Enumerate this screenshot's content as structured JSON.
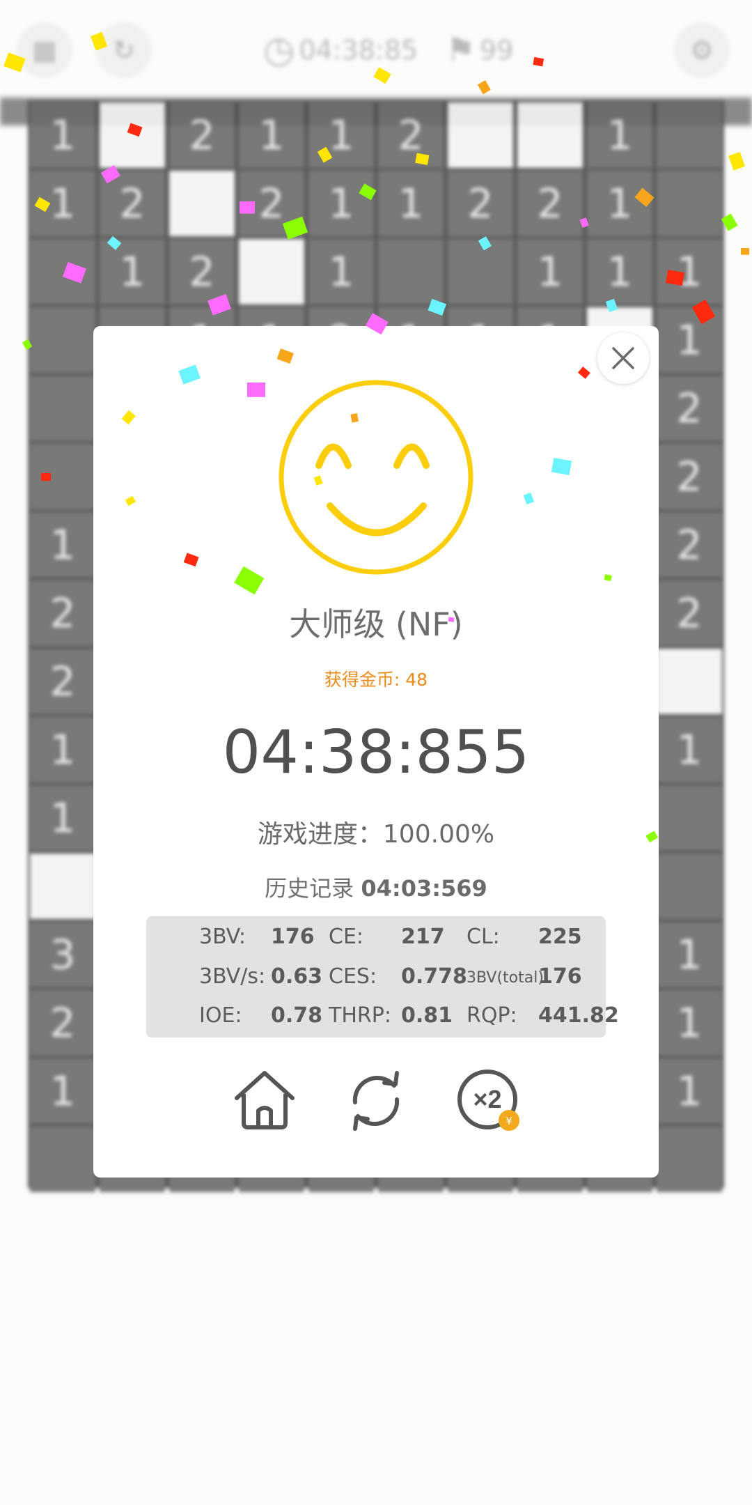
{
  "topbar": {
    "timer_text": "04:38:85",
    "flags_text": "99"
  },
  "board": {
    "rows": [
      [
        "1",
        "",
        "2",
        "1",
        "1",
        "2",
        "",
        "",
        "1",
        ""
      ],
      [
        "1",
        "2",
        "",
        "2",
        "1",
        "1",
        "2",
        "2",
        "1",
        ""
      ],
      [
        "",
        "1",
        "2",
        "",
        "1",
        "",
        "",
        "1",
        "1",
        "1"
      ],
      [
        "",
        "",
        "1",
        "1",
        "2",
        "1",
        "1",
        "1",
        "",
        "1"
      ],
      [
        "",
        "",
        "",
        "",
        "",
        "",
        "",
        "",
        "",
        "2"
      ],
      [
        "",
        "",
        "",
        "",
        "",
        "",
        "",
        "",
        "",
        "2"
      ],
      [
        "1",
        "",
        "",
        "",
        "",
        "",
        "",
        "",
        "",
        "2"
      ],
      [
        "2",
        "",
        "",
        "",
        "",
        "",
        "",
        "",
        "",
        "2"
      ],
      [
        "2",
        "",
        "",
        "",
        "",
        "",
        "",
        "",
        "",
        ""
      ],
      [
        "1",
        "",
        "",
        "",
        "",
        "",
        "",
        "",
        "",
        "1"
      ],
      [
        "1",
        "",
        "",
        "",
        "",
        "",
        "",
        "",
        "",
        ""
      ],
      [
        "",
        "",
        "",
        "",
        "",
        "",
        "",
        "",
        "",
        ""
      ],
      [
        "3",
        "",
        "",
        "",
        "",
        "",
        "",
        "",
        "",
        "1"
      ],
      [
        "2",
        "",
        "",
        "",
        "",
        "",
        "",
        "",
        "",
        "1"
      ],
      [
        "1",
        "",
        "",
        "",
        "",
        "",
        "",
        "",
        "",
        "1"
      ],
      [
        "",
        "",
        "",
        "",
        "",
        "",
        "",
        "",
        "",
        ""
      ]
    ],
    "open_cells": [
      "0-1",
      "0-6",
      "0-7",
      "1-2",
      "2-3",
      "3-8",
      "8-9",
      "11-0"
    ]
  },
  "dialog": {
    "title": "大师级 (NF)",
    "coins": "获得金币: 48",
    "time": "04:38:855",
    "progress": "游戏进度：100.00%",
    "record_label": "历史记录 ",
    "record_value": "04:03:569",
    "stats": {
      "bbbv_label": "3BV:",
      "bbbv_value": "176",
      "ce_label": "CE:",
      "ce_value": "217",
      "cl_label": "CL:",
      "cl_value": "225",
      "bbbvs_label": "3BV/s:",
      "bbbvs_value": "0.63",
      "ces_label": "CES:",
      "ces_value": "0.778",
      "bbbv_total_label": "3BV(total):",
      "bbbv_total_value": "176",
      "ioe_label": "IOE:",
      "ioe_value": "0.78",
      "thrp_label": "THRP:",
      "thrp_value": "0.81",
      "rqp_label": "RQP:",
      "rqp_value": "441.82"
    },
    "actions": {
      "home_icon": "home-icon",
      "restart_icon": "refresh-icon",
      "double_icon": "x2-icon",
      "double_text": "×2",
      "coin_text": "¥"
    }
  },
  "colors": {
    "smiley": "#fbcd0b",
    "coins_text": "#ea8a1a",
    "stats_bg": "#e2e2e2"
  }
}
